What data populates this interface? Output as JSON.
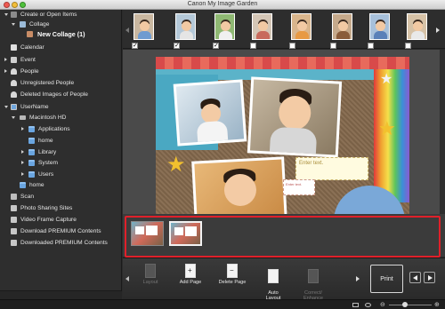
{
  "window": {
    "title": "Canon My Image Garden"
  },
  "sidebar": {
    "items": [
      {
        "label": "Create or Open Items"
      },
      {
        "label": "Collage"
      },
      {
        "label": "New Collage (1)"
      },
      {
        "label": "Calendar"
      },
      {
        "label": "Event"
      },
      {
        "label": "People"
      },
      {
        "label": "Unregistered People"
      },
      {
        "label": "Deleted Images of People"
      },
      {
        "label": "UserName"
      },
      {
        "label": "Macintosh HD"
      },
      {
        "label": "Applications"
      },
      {
        "label": "home"
      },
      {
        "label": "Library"
      },
      {
        "label": "System"
      },
      {
        "label": "Users"
      },
      {
        "label": "home"
      },
      {
        "label": "Scan"
      },
      {
        "label": "Photo Sharing Sites"
      },
      {
        "label": "Video Frame Capture"
      },
      {
        "label": "Download PREMIUM Contents"
      },
      {
        "label": "Downloaded PREMIUM Contents"
      }
    ]
  },
  "collage": {
    "textbox_main": "Enter text.",
    "textbox_small": "Enter text."
  },
  "toolbar": {
    "layout_label": "Layout",
    "add_page_label": "Add Page",
    "delete_page_label": "Delete Page",
    "auto_layout_label": "Auto\nLayout",
    "correct_enhance_label": "Correct/\nEnhance",
    "print_label": "Print"
  },
  "colors": {
    "highlight": "#e0202a",
    "accent_blue": "#6aa5e0"
  },
  "icons": {
    "collage": "collage-icon",
    "calendar": "calendar-icon",
    "event": "event-icon",
    "people": "people-icon"
  }
}
